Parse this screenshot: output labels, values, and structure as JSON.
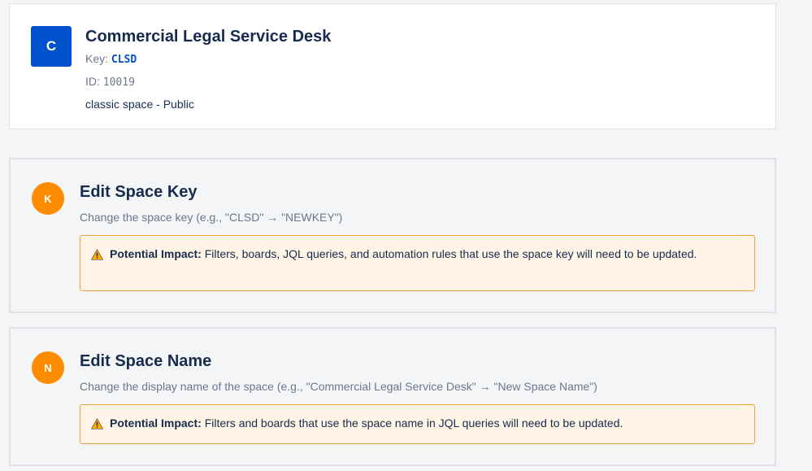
{
  "header": {
    "avatar_letter": "C",
    "title": "Commercial Legal Service Desk",
    "key_label": "Key:",
    "key_value": "CLSD",
    "id_label": "ID:",
    "id_value": "10019",
    "type_line": "classic space - Public"
  },
  "sections": [
    {
      "badge": "K",
      "title": "Edit Space Key",
      "description": "Change the space key (e.g., \"CLSD\" → \"NEWKEY\")",
      "impact_label": "Potential Impact:",
      "impact_text": "Filters, boards, JQL queries, and automation rules that use the space key will need to be updated."
    },
    {
      "badge": "N",
      "title": "Edit Space Name",
      "description": "Change the display name of the space (e.g., \"Commercial Legal Service Desk\" → \"New Space Name\")",
      "impact_label": "Potential Impact:",
      "impact_text": "Filters and boards that use the space name in JQL queries will need to be updated."
    }
  ],
  "icons": {
    "warning": "warning-triangle-icon"
  },
  "colors": {
    "brand_blue": "#0052cc",
    "badge_orange": "#ff8b00",
    "warning_bg": "#fff4e5",
    "warning_border": "#f0a13a"
  }
}
